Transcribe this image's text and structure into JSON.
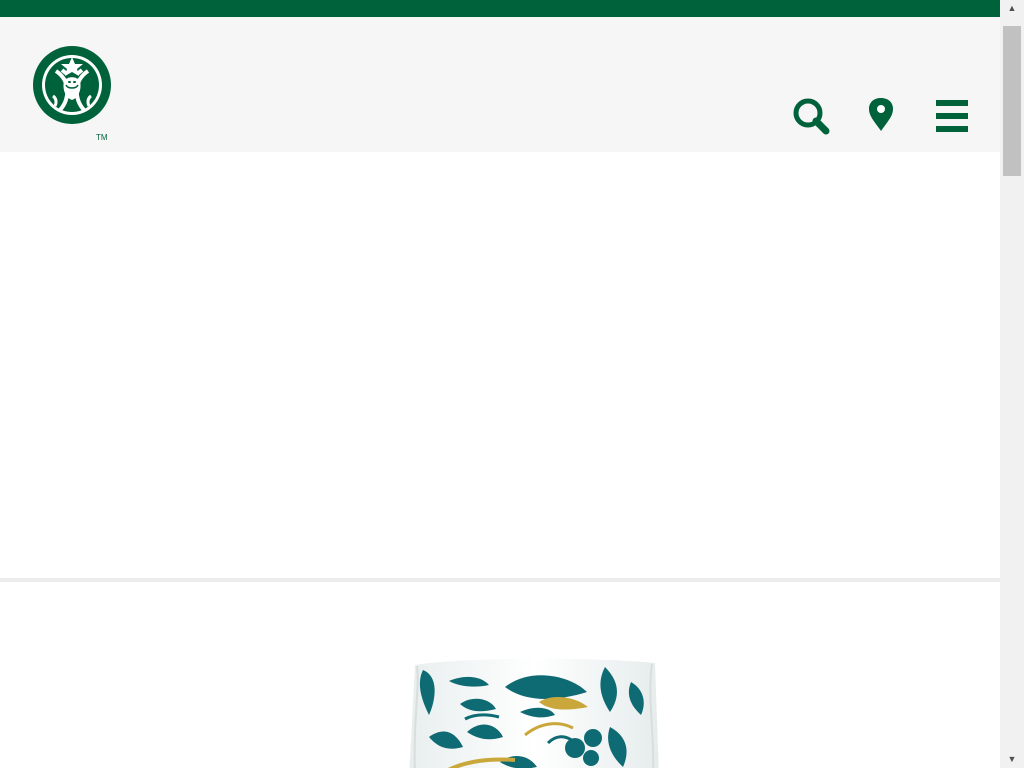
{
  "brand": {
    "name": "Starbucks",
    "trademark": "TM",
    "logo_icon": "siren-logo-icon",
    "primary_color": "#00623b"
  },
  "header": {
    "actions": [
      {
        "name": "search",
        "icon": "search-icon"
      },
      {
        "name": "store-locator",
        "icon": "location-pin-icon"
      },
      {
        "name": "menu",
        "icon": "hamburger-menu-icon"
      }
    ]
  },
  "product": {
    "image": "coffee-bag-image",
    "pattern_colors": [
      "#0f6b73",
      "#c9a73a",
      "#ffffff"
    ]
  },
  "scrollbar": {
    "up_arrow": "▲",
    "down_arrow": "▼"
  }
}
